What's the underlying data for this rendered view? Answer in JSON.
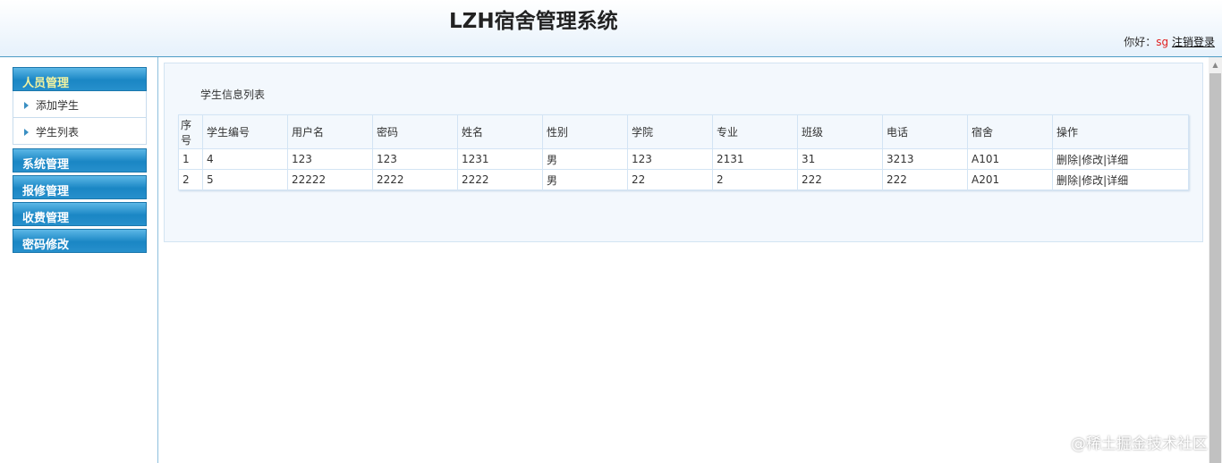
{
  "header": {
    "title": "LZH宿舍管理系统",
    "greeting": "你好：",
    "username": "sg",
    "logout": "注销登录"
  },
  "sidebar": {
    "groups": [
      {
        "label": "人员管理",
        "items": [
          "添加学生",
          "学生列表"
        ]
      },
      {
        "label": "系统管理"
      },
      {
        "label": "报修管理"
      },
      {
        "label": "收费管理"
      },
      {
        "label": "密码修改"
      }
    ]
  },
  "main": {
    "title": "学生信息列表",
    "columns": [
      "序号",
      "学生编号",
      "用户名",
      "密码",
      "姓名",
      "性别",
      "学院",
      "专业",
      "班级",
      "电话",
      "宿舍",
      "操作"
    ],
    "rows": [
      [
        "1",
        "4",
        "123",
        "123",
        "1231",
        "男",
        "123",
        "2131",
        "31",
        "3213",
        "A101"
      ],
      [
        "2",
        "5",
        "22222",
        "2222",
        "2222",
        "男",
        "22",
        "2",
        "222",
        "222",
        "A201"
      ]
    ],
    "actions": {
      "delete": "删除",
      "edit": "修改",
      "detail": "详细",
      "sep": "|"
    }
  },
  "watermark": "@稀土掘金技术社区"
}
